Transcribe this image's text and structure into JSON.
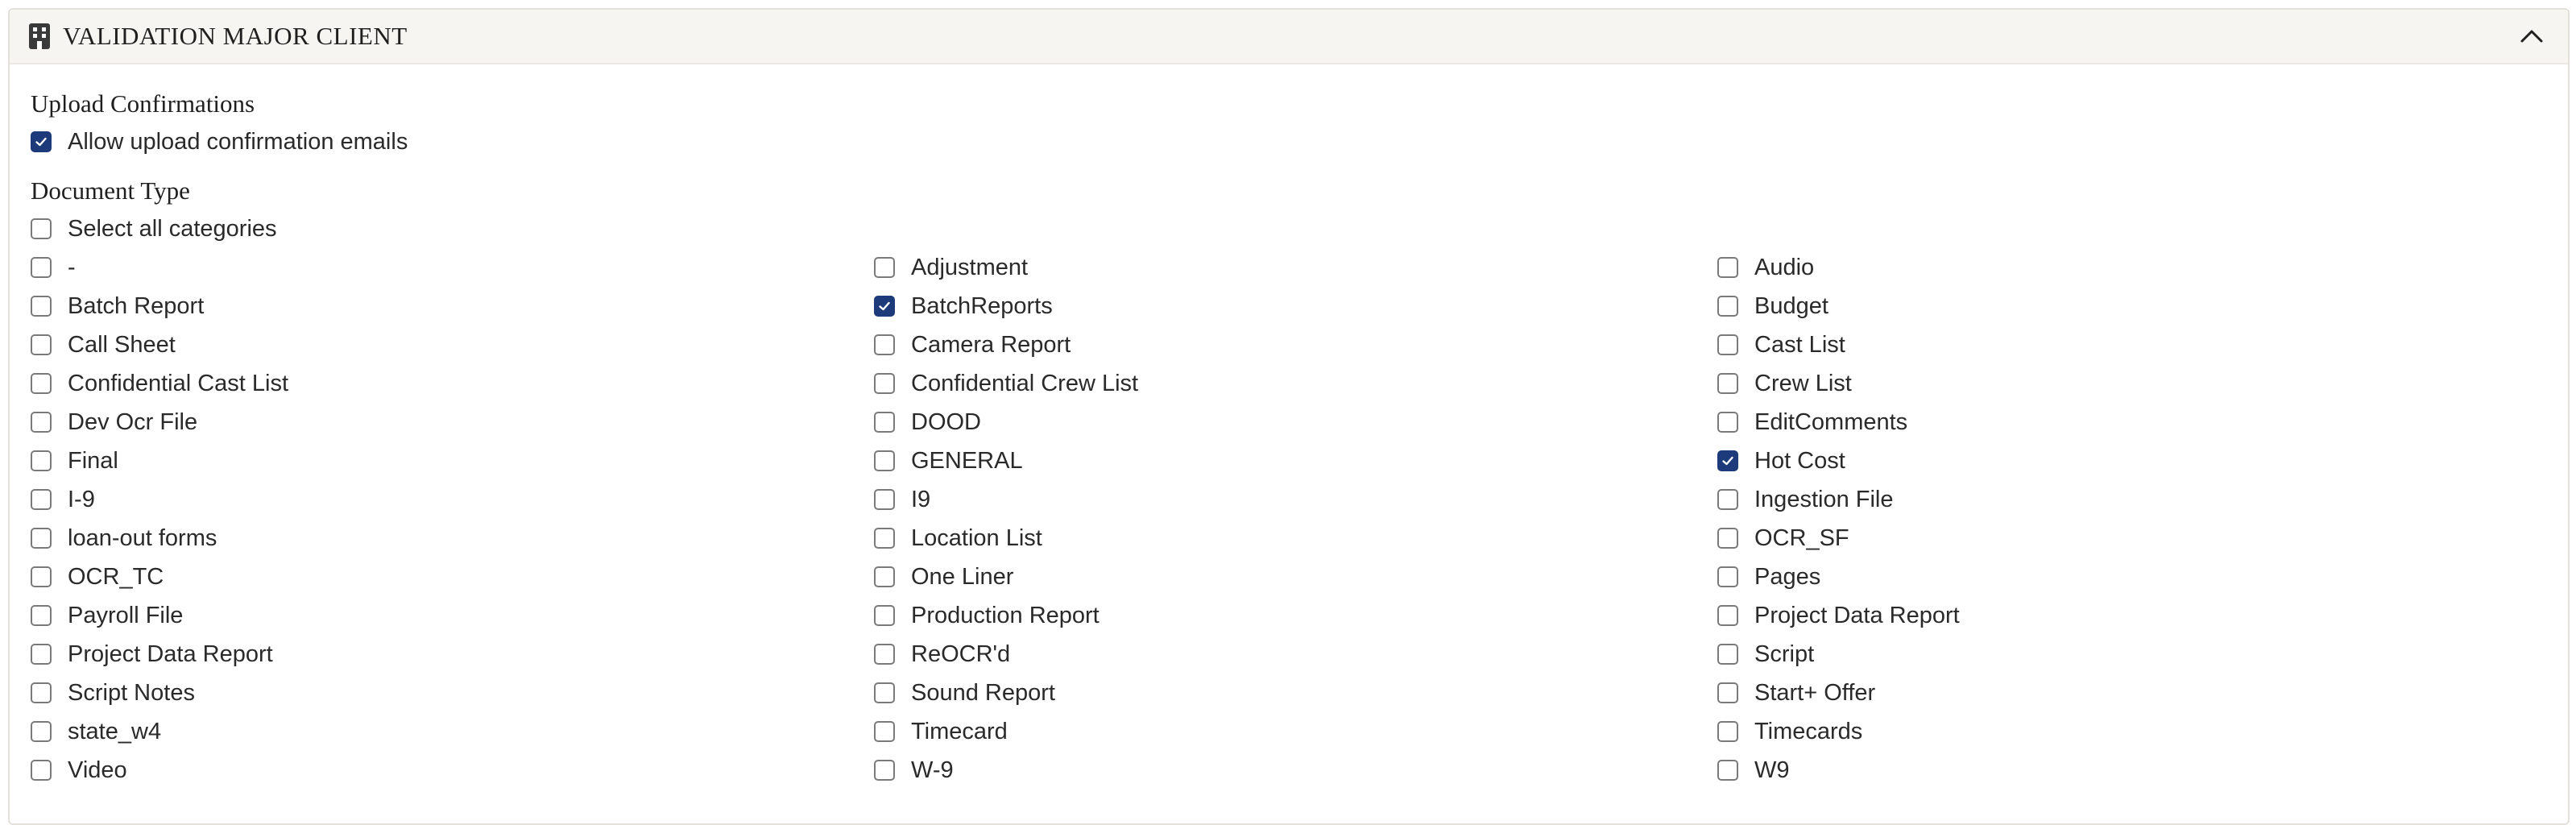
{
  "panel": {
    "title": "VALIDATION MAJOR CLIENT",
    "header_icon": "building-icon",
    "collapse_icon": "chevron-up-icon"
  },
  "upload": {
    "title": "Upload Confirmations",
    "allow_label": "Allow upload confirmation emails",
    "allow_checked": true
  },
  "doc_type": {
    "title": "Document Type",
    "select_all_label": "Select all categories",
    "select_all_checked": false,
    "items": [
      {
        "label": "-",
        "checked": false
      },
      {
        "label": "Adjustment",
        "checked": false
      },
      {
        "label": "Audio",
        "checked": false
      },
      {
        "label": "Batch Report",
        "checked": false
      },
      {
        "label": "BatchReports",
        "checked": true
      },
      {
        "label": "Budget",
        "checked": false
      },
      {
        "label": "Call Sheet",
        "checked": false
      },
      {
        "label": "Camera Report",
        "checked": false
      },
      {
        "label": "Cast List",
        "checked": false
      },
      {
        "label": "Confidential Cast List",
        "checked": false
      },
      {
        "label": "Confidential Crew List",
        "checked": false
      },
      {
        "label": "Crew List",
        "checked": false
      },
      {
        "label": "Dev Ocr File",
        "checked": false
      },
      {
        "label": "DOOD",
        "checked": false
      },
      {
        "label": "EditComments",
        "checked": false
      },
      {
        "label": "Final",
        "checked": false
      },
      {
        "label": "GENERAL",
        "checked": false
      },
      {
        "label": "Hot Cost",
        "checked": true
      },
      {
        "label": "I-9",
        "checked": false
      },
      {
        "label": "I9",
        "checked": false
      },
      {
        "label": "Ingestion File",
        "checked": false
      },
      {
        "label": "loan-out forms",
        "checked": false
      },
      {
        "label": "Location List",
        "checked": false
      },
      {
        "label": "OCR_SF",
        "checked": false
      },
      {
        "label": "OCR_TC",
        "checked": false
      },
      {
        "label": "One Liner",
        "checked": false
      },
      {
        "label": "Pages",
        "checked": false
      },
      {
        "label": "Payroll File",
        "checked": false
      },
      {
        "label": "Production Report",
        "checked": false
      },
      {
        "label": "Project Data Report",
        "checked": false
      },
      {
        "label": "Project Data Report",
        "checked": false
      },
      {
        "label": "ReOCR'd",
        "checked": false
      },
      {
        "label": "Script",
        "checked": false
      },
      {
        "label": "Script Notes",
        "checked": false
      },
      {
        "label": "Sound Report",
        "checked": false
      },
      {
        "label": "Start+ Offer",
        "checked": false
      },
      {
        "label": "state_w4",
        "checked": false
      },
      {
        "label": "Timecard",
        "checked": false
      },
      {
        "label": "Timecards",
        "checked": false
      },
      {
        "label": "Video",
        "checked": false
      },
      {
        "label": "W-9",
        "checked": false
      },
      {
        "label": "W9",
        "checked": false
      }
    ]
  },
  "colors": {
    "accent": "#1d3a7a",
    "header_bg": "#f7f5f2"
  }
}
